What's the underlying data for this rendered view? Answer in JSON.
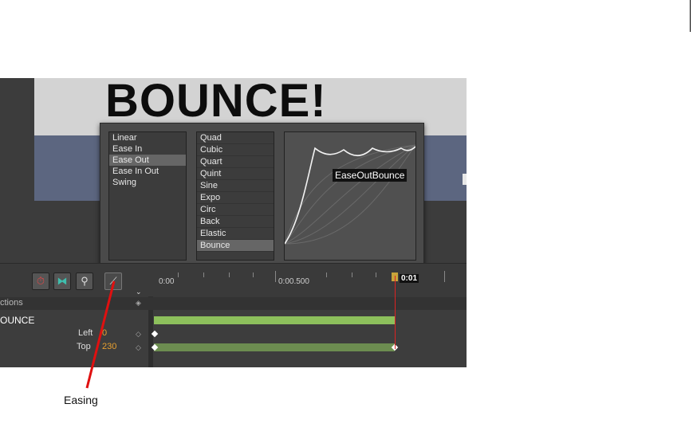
{
  "stage": {
    "title": "BOUNCE!"
  },
  "easing_popup": {
    "directions": [
      "Linear",
      "Ease In",
      "Ease Out",
      "Ease In Out",
      "Swing"
    ],
    "selected_direction": "Ease Out",
    "types": [
      "Quad",
      "Cubic",
      "Quart",
      "Quint",
      "Sine",
      "Expo",
      "Circ",
      "Back",
      "Elastic",
      "Bounce"
    ],
    "selected_type": "Bounce",
    "preview_label": "EaseOutBounce"
  },
  "toolbar": {
    "icons": [
      "stopwatch-icon",
      "transition-icon",
      "pin-icon",
      "easing-curve-icon",
      "chevron-down-icon"
    ]
  },
  "timeline": {
    "ruler": {
      "start": "0:00",
      "mid": "0:00.500",
      "playhead": "0:01"
    },
    "section_header": "ctions",
    "element_name": "OUNCE",
    "properties": [
      {
        "name": "Left",
        "value": "0"
      },
      {
        "name": "Top",
        "value": "230"
      }
    ],
    "colors": {
      "track_bar": "#8dc05c",
      "playhead": "#dd2222",
      "value": "#e8a030"
    }
  },
  "annotation": {
    "label": "Easing",
    "color": "#e01010"
  }
}
